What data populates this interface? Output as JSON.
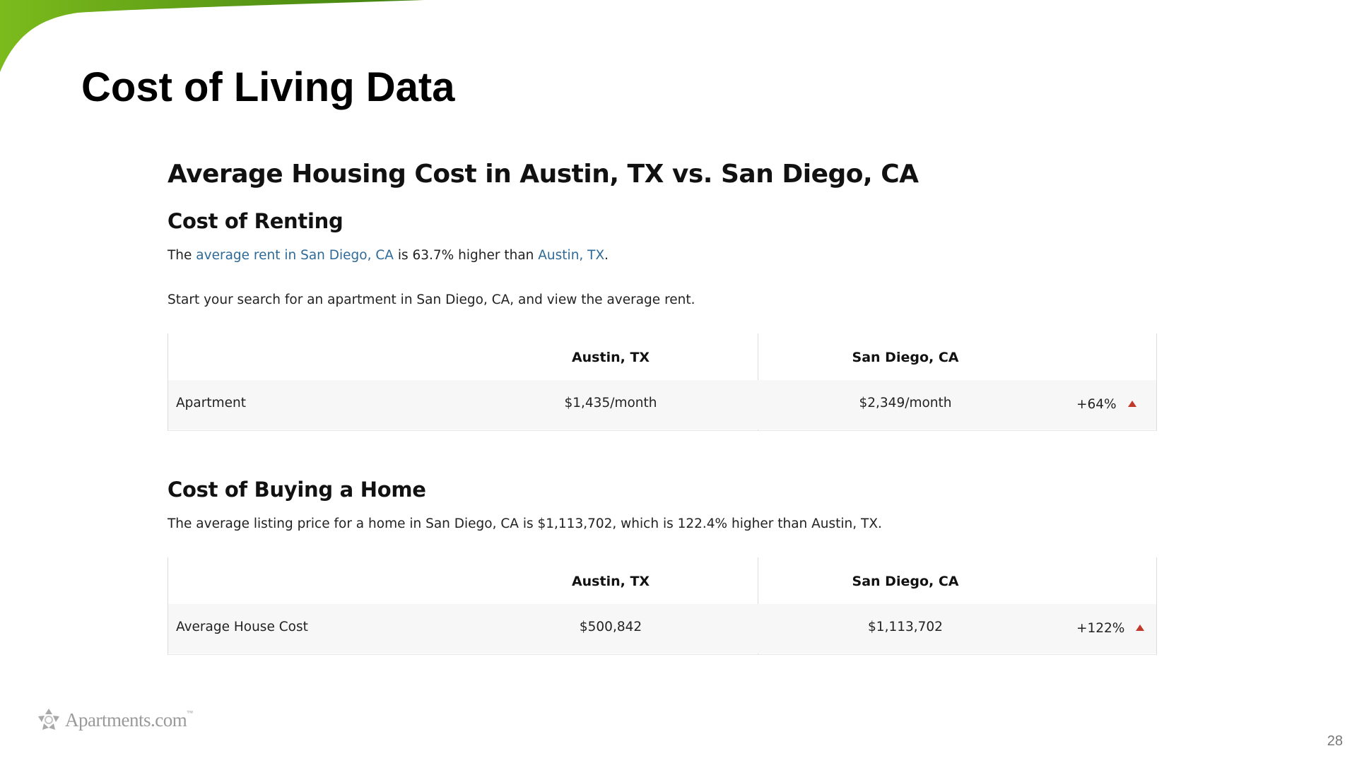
{
  "slide": {
    "title": "Cost of Living Data",
    "page_number": "28",
    "accent_color": "#6aaa1e"
  },
  "section": {
    "heading": "Average Housing Cost in Austin, TX vs. San Diego, CA"
  },
  "renting": {
    "heading": "Cost of Renting",
    "sentence": {
      "prefix": "The ",
      "link1": "average rent in San Diego, CA",
      "middle": " is 63.7% higher than ",
      "link2": "Austin, TX",
      "suffix": "."
    },
    "cta": "Start your search for an apartment in San Diego, CA, and view the average rent.",
    "table": {
      "col1": "Austin, TX",
      "col2": "San Diego, CA",
      "row_label": "Apartment",
      "value1": "$1,435/month",
      "value2": "$2,349/month",
      "change": "+64%"
    }
  },
  "buying": {
    "heading": "Cost of Buying a Home",
    "sentence": "The average listing price for a home in San Diego, CA is $1,113,702, which is 122.4% higher than Austin, TX.",
    "table": {
      "col1": "Austin, TX",
      "col2": "San Diego, CA",
      "row_label": "Average House Cost",
      "value1": "$500,842",
      "value2": "$1,113,702",
      "change": "+122%"
    }
  },
  "logo": {
    "text": "Apartments.com",
    "tm": "™"
  }
}
